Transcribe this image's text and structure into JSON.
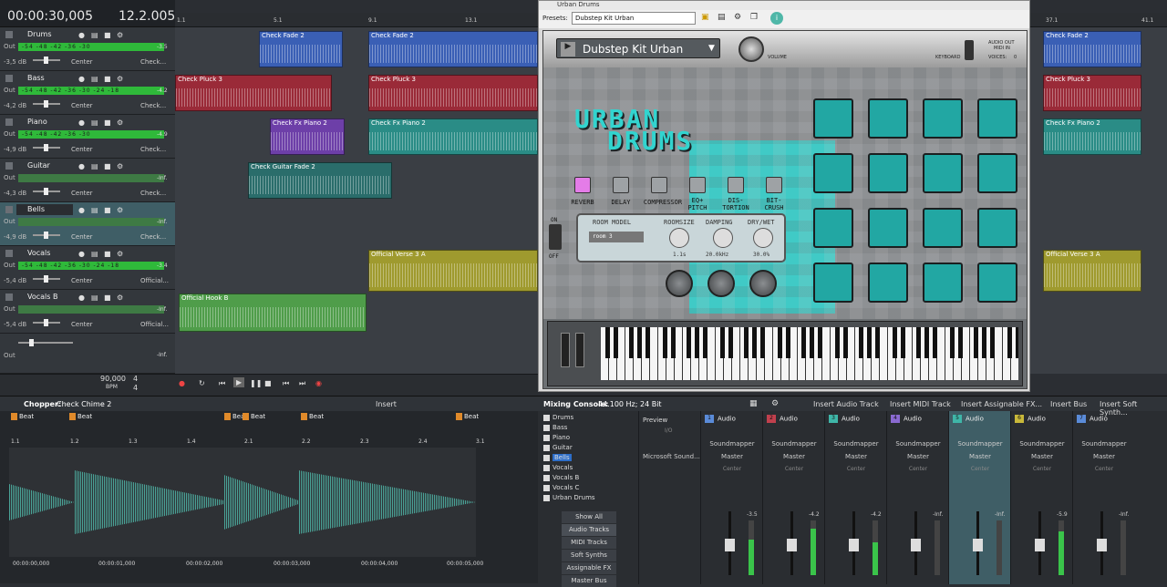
{
  "time": {
    "position": "00:00:30,005",
    "bars": "12.2.005"
  },
  "ruler_marks": [
    "1.1",
    "5.1",
    "9.1",
    "13.1",
    "37.1",
    "41.1"
  ],
  "tracks": [
    {
      "num": "1",
      "name": "Drums",
      "meter": "-54 -48 -42 -36 -30",
      "peak": "-3.5",
      "db": "-3,5 dB",
      "pan": "Center",
      "fx": "Check..."
    },
    {
      "num": "2",
      "name": "Bass",
      "meter": "-54 -48 -42 -36 -30 -24 -18",
      "peak": "-4.2",
      "db": "-4,2 dB",
      "pan": "Center",
      "fx": "Check..."
    },
    {
      "num": "3",
      "name": "Piano",
      "meter": "-54 -48 -42 -36 -30",
      "peak": "-4.9",
      "db": "-4,9 dB",
      "pan": "Center",
      "fx": "Check..."
    },
    {
      "num": "4",
      "name": "Guitar",
      "meter": "",
      "peak": "-Inf.",
      "db": "-4,3 dB",
      "pan": "Center",
      "fx": "Check..."
    },
    {
      "num": "5",
      "name": "Bells",
      "meter": "",
      "peak": "-Inf.",
      "db": "-4,9 dB",
      "pan": "Center",
      "fx": "Check..."
    },
    {
      "num": "6",
      "name": "Vocals",
      "meter": "-54 -48 -42 -36 -30 -24 -18",
      "peak": "-3.4",
      "db": "-5,4 dB",
      "pan": "Center",
      "fx": "Official..."
    },
    {
      "num": "7",
      "name": "Vocals B",
      "meter": "",
      "peak": "-Inf.",
      "db": "-5,4 dB",
      "pan": "Center",
      "fx": "Official..."
    }
  ],
  "master_row": {
    "out": "Out",
    "peak": "-Inf."
  },
  "clips": [
    {
      "name": "Check Fade 2",
      "color": "#3a5fb5"
    },
    {
      "name": "Check Fade 2",
      "color": "#3a5fb5"
    },
    {
      "name": "Check Pluck 3",
      "color": "#9a2a38"
    },
    {
      "name": "Check Fx Piano 2",
      "color": "#6d3fa8"
    },
    {
      "name": "Check Guitar Fade 2",
      "color": "#2a8c86"
    },
    {
      "name": "Official Verse 3 A",
      "color": "#9f9a2e"
    },
    {
      "name": "Official Hook B",
      "color": "#4f9d4a"
    }
  ],
  "transport": {
    "tempo": "90,000",
    "tempo_unit": "BPM",
    "sig_top": "4",
    "sig_bottom": "4"
  },
  "chopper": {
    "title": "Chopper:",
    "clip": "Check Chime 2",
    "insert": "Insert",
    "markers": [
      "1.1",
      "1.2",
      "1.3",
      "1.4",
      "2.1",
      "2.2",
      "2.3",
      "2.4",
      "3.1"
    ],
    "beat_label": "Beat",
    "times": [
      "00:00:00,000",
      "00:00:01,000",
      "00:00:02,000",
      "00:00:03,000",
      "00:00:04,000",
      "00:00:05,000"
    ]
  },
  "plugin": {
    "window_title": "Urban Drums",
    "presets_label": "Presets:",
    "preset_value": "Dubstep Kit Urban",
    "kit_name": "Dubstep Kit Urban",
    "volume_label": "VOLUME",
    "keyboard_label": "KEYBOARD",
    "audio_out": "AUDIO OUT",
    "midi_in": "MIDI IN",
    "voices_label": "VOICES:",
    "voices": "0",
    "logo_line1": "URBAN",
    "logo_line2": "DRUMS",
    "effects": [
      "REVERB",
      "DELAY",
      "COMPRESSOR",
      "EQ+ PITCH",
      "DIS- TORTION",
      "BIT- CRUSH"
    ],
    "on": "ON",
    "off": "OFF",
    "room_model_label": "ROOM MODEL",
    "room_model": "room 3",
    "roomsize_label": "ROOMSIZE",
    "roomsize": "1.1s",
    "damping_label": "DAMPING",
    "damping": "20.0kHz",
    "drywet_label": "DRY/WET",
    "drywet": "30.0%"
  },
  "console": {
    "title": "Mixing Console:",
    "info": "44.100 Hz; 24 Bit",
    "actions": [
      "Insert Audio Track",
      "Insert MIDI Track",
      "Insert Assignable FX...",
      "Insert Bus",
      "Insert Soft Synth..."
    ],
    "list": [
      "Drums",
      "Bass",
      "Piano",
      "Guitar",
      "Bells",
      "Vocals",
      "Vocals B",
      "Vocals C",
      "Urban Drums"
    ],
    "buttons": [
      "Show All",
      "Audio Tracks",
      "MIDI Tracks",
      "Soft Synths",
      "Assignable FX",
      "Master Bus"
    ],
    "preview": "Preview",
    "io": "I/O",
    "device": "Microsoft Sound...",
    "strips": [
      {
        "n": "1",
        "name": "Audio",
        "color": "#5a8bd8",
        "src": "Soundmapper",
        "out": "Master",
        "pan": "Center",
        "peak": "-3.5",
        "level": 0.65
      },
      {
        "n": "2",
        "name": "Audio",
        "color": "#c0404d",
        "src": "Soundmapper",
        "out": "Master",
        "pan": "Center",
        "peak": "-4.2",
        "level": 0.85
      },
      {
        "n": "3",
        "name": "Audio",
        "color": "#3fb6a8",
        "src": "Soundmapper",
        "out": "Master",
        "pan": "Center",
        "peak": "-4.2",
        "level": 0.6
      },
      {
        "n": "4",
        "name": "Audio",
        "color": "#8a6ad0",
        "src": "Soundmapper",
        "out": "Master",
        "pan": "Center",
        "peak": "-Inf.",
        "level": 0.0
      },
      {
        "n": "5",
        "name": "Audio",
        "color": "#3fb6a8",
        "src": "Soundmapper",
        "out": "Master",
        "pan": "Center",
        "peak": "-Inf.",
        "level": 0.0
      },
      {
        "n": "6",
        "name": "Audio",
        "color": "#c8b83a",
        "src": "Soundmapper",
        "out": "Master",
        "pan": "Center",
        "peak": "-5.9",
        "level": 0.8
      },
      {
        "n": "7",
        "name": "Audio",
        "color": "#5a8bd8",
        "src": "Soundmapper",
        "out": "Master",
        "pan": "Center",
        "peak": "-Inf.",
        "level": 0.0
      }
    ]
  }
}
